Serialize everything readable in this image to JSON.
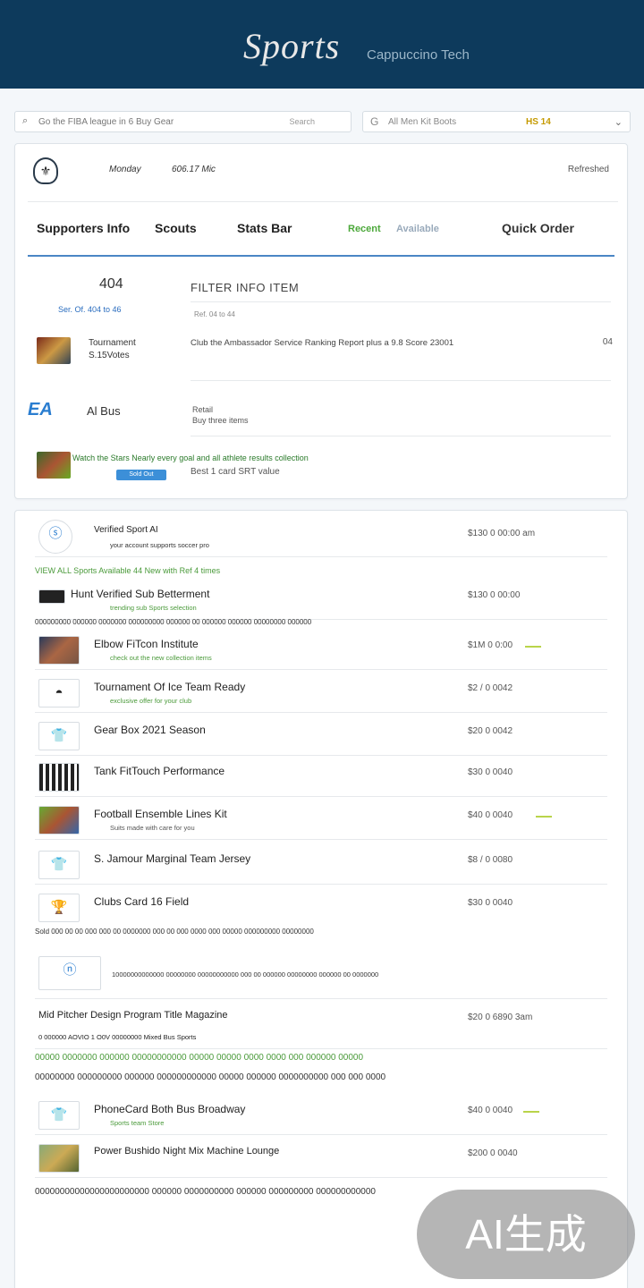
{
  "header": {
    "logo": "Sports",
    "logo_sub": "Cappuccino Tech"
  },
  "search": {
    "text": "Go the FIBA league in 6 Buy Gear",
    "button": "Search"
  },
  "filter": {
    "text": "All   Men   Kit   Boots",
    "tag": "HS 14"
  },
  "summary": {
    "meta1": "Monday",
    "meta2": "606.17 Mic",
    "meta3": "Refreshed",
    "tabs": [
      "Supporters Info",
      "Scouts",
      "Stats Bar",
      "Recent",
      "Quick Order"
    ],
    "tab_green_small": "Available",
    "num": "404",
    "sub": "Ser. Of. 404 to 46",
    "col_header": "FILTER INFO ITEM",
    "col_sub": "Ref. 04 to 44",
    "row1_name": [
      "Tournament",
      "S.15Votes"
    ],
    "row1_desc": "Club the Ambassador Service Ranking Report plus a 9.8 Score 23001",
    "row1_flag": "04",
    "logo2": "EA",
    "val2": "Al Bus",
    "lbl2": [
      "Retail",
      "Buy three items"
    ],
    "desc3": "Watch the Stars Nearly every goal and all athlete results collection",
    "desc3b": "Best 1 card SRT value",
    "chip3": "Sold Out"
  },
  "list": [
    {
      "title": "Verified Sport AI",
      "small": "your account supports soccer pro",
      "price": "$130 0 00:00 am"
    },
    {
      "title": "Hunt Verified Sub Betterment",
      "small": "trending sub Sports selection",
      "price": "$130 0 00:00"
    },
    {
      "title": "Elbow FiTcon Institute",
      "small": "check out the new collection items",
      "price": "$1M 0 0:00"
    },
    {
      "title": "Tournament Of Ice Team Ready",
      "small": "exclusive offer for your club",
      "price": "$2 / 0 0042"
    },
    {
      "title": "Gear Box 2021 Season",
      "small": "",
      "price": "$20 0 0042"
    },
    {
      "title": "Tank FitTouch Performance",
      "small": "",
      "price": "$30 0 0040"
    },
    {
      "title": "Football Ensemble Lines Kit",
      "small": "Suits made with care for you",
      "price": "$40 0 0040"
    },
    {
      "title": "S. Jamour Marginal Team Jersey",
      "small": "",
      "price": "$8 / 0 0080"
    },
    {
      "title": "Clubs Card 16 Field",
      "small": "",
      "price": "$30 0 0040"
    },
    {
      "title": "Mid Pitcher Design Program Title Magazine",
      "small": "",
      "price": "$20 0 6890 3am"
    },
    {
      "title": "PhoneCard Both Bus Broadway",
      "small": "Sports team Store",
      "price": "$40 0 0040"
    },
    {
      "title": "Power Bushido Night Mix Machine Lounge",
      "small": "",
      "price": "$200 0 0040"
    }
  ],
  "lines": {
    "l1": "VIEW ALL   Sports   Available 44   New with Ref 4 times",
    "l2": "000000000 000000 0000000 000000000 000000 00 000000 000000 00000000 000000",
    "l3": "Sold 000 00 00 000 000 00 0000000 000 00 000 0000 000 00000 000000000 00000000",
    "l4": "10000000000000 00000000 00000000000 000 00 000000 00000000 000000 00 0000000",
    "l5": "0 000000 AOVIO 1 O0V 00000000 Mixed Bus Sports",
    "l6": "00000 0000000 000000 00000000000 00000 00000 0000 0000 000 000000 00000",
    "l7": "00000000 000000000 000000 000000000000 00000 000000 0000000000 000 000 0000",
    "l8": "00000000000000000000000 000000 0000000000 000000 000000000 000000000000"
  },
  "watermark": "AI生成",
  "colors": {
    "header": "#0d3a5c",
    "accent": "#4a86c5",
    "green": "#4ca83a"
  }
}
